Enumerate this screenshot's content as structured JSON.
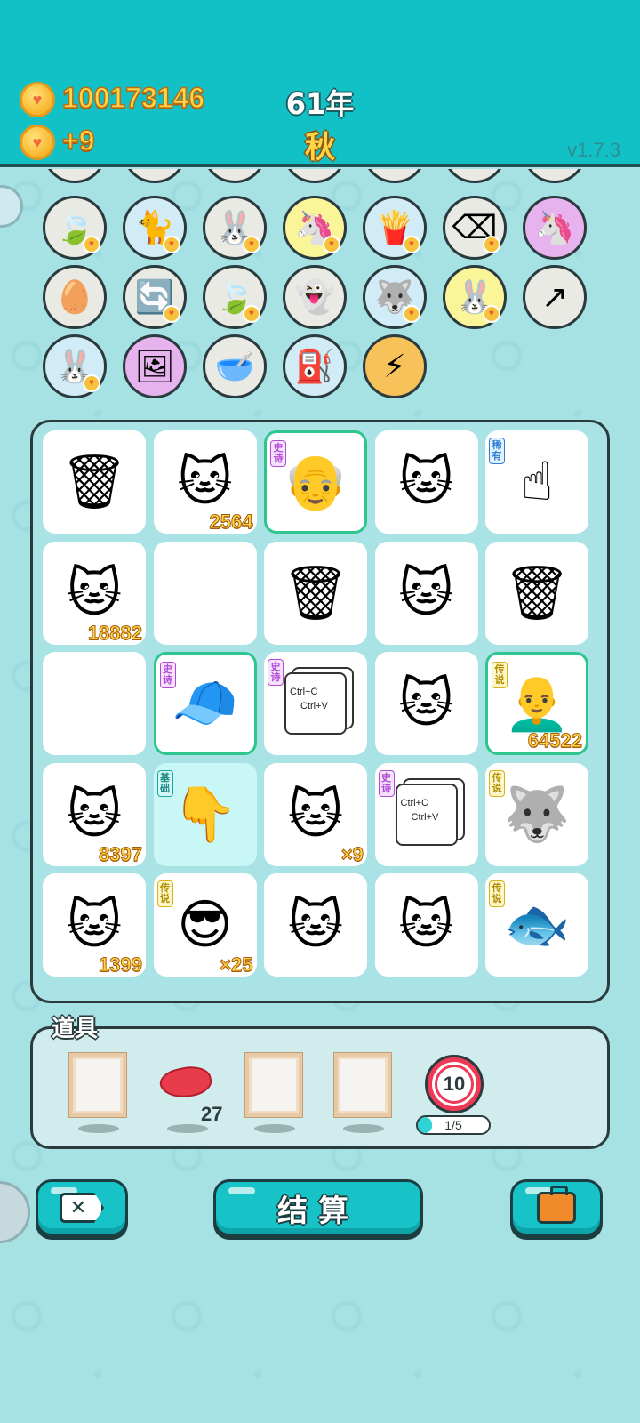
{
  "header": {
    "gold_amount": "100173146",
    "gold_income": "+9",
    "year": "61年",
    "season": "秋",
    "version": "v1.7.3"
  },
  "items_rows": [
    [
      {
        "name": "leaf-icon",
        "glyph": "🍃",
        "bg": "#e8eae3",
        "heart": true
      },
      {
        "name": "cat-back-icon",
        "glyph": "🐈",
        "bg": "#d2ecf7",
        "heart": true
      },
      {
        "name": "rabbit-icon",
        "glyph": "🐰",
        "bg": "#e8eae3",
        "heart": true
      },
      {
        "name": "unicorn-icon",
        "glyph": "🦄",
        "bg": "#fbf59a",
        "heart": true
      },
      {
        "name": "fries-icon",
        "glyph": "🍟",
        "bg": "#d2ecf7",
        "heart": true
      },
      {
        "name": "delete-tag-icon",
        "glyph": "⌫",
        "bg": "#e8eae3",
        "heart": true
      },
      {
        "name": "unicorn-pair-icon",
        "glyph": "🦄",
        "bg": "#e7b3ef",
        "heart": false
      }
    ],
    [
      {
        "name": "egg-tray-icon",
        "glyph": "🥚",
        "bg": "#e8eae3",
        "heart": false
      },
      {
        "name": "refresh-icon",
        "glyph": "🔄",
        "bg": "#e8eae3",
        "heart": true
      },
      {
        "name": "leaf-icon",
        "glyph": "🍃",
        "bg": "#e8eae3",
        "heart": true
      },
      {
        "name": "ghost-icon",
        "glyph": "👻",
        "bg": "#e8eae3",
        "heart": false
      },
      {
        "name": "husky-icon",
        "glyph": "🐺",
        "bg": "#d2ecf7",
        "heart": true
      },
      {
        "name": "rabbit-icon",
        "glyph": "🐰",
        "bg": "#fbf59a",
        "heart": true
      },
      {
        "name": "arrow-card-icon",
        "glyph": "↗",
        "bg": "#e8eae3",
        "heart": false
      }
    ],
    [
      {
        "name": "rabbit-icon",
        "glyph": "🐰",
        "bg": "#d2ecf7",
        "heart": true
      },
      {
        "name": "crown-frame-icon",
        "glyph": "🖼",
        "bg": "#e7b3ef",
        "heart": false
      },
      {
        "name": "dog-bowl-icon",
        "glyph": "🥣",
        "bg": "#e8eae3",
        "heart": false
      },
      {
        "name": "pump-icon",
        "glyph": "⛽",
        "bg": "#d2ecf7",
        "heart": false
      },
      {
        "name": "lightning-icon",
        "glyph": "⚡",
        "bg": "#f7c25a",
        "heart": false
      }
    ]
  ],
  "board": [
    [
      {
        "name": "garbage-bag-icon",
        "glyph": "🗑",
        "tag": "",
        "tag_color": "",
        "count": "",
        "style": ""
      },
      {
        "name": "cat-icon",
        "glyph": "🐱",
        "tag": "",
        "tag_color": "",
        "count": "2564",
        "style": ""
      },
      {
        "name": "old-man-icon",
        "glyph": "👴",
        "tag": "史诗",
        "tag_color": "purple",
        "count": "",
        "style": "bordered"
      },
      {
        "name": "cat-icon",
        "glyph": "🐱",
        "tag": "",
        "tag_color": "",
        "count": "",
        "style": ""
      },
      {
        "name": "pointing-finger-icon",
        "glyph": "☝",
        "tag": "稀有",
        "tag_color": "blue",
        "count": "",
        "style": ""
      }
    ],
    [
      {
        "name": "cat-icon",
        "glyph": "🐱",
        "tag": "",
        "tag_color": "",
        "count": "18882",
        "style": ""
      },
      {
        "name": "empty-slot",
        "glyph": "",
        "tag": "",
        "tag_color": "",
        "count": "",
        "style": ""
      },
      {
        "name": "garbage-bag-icon",
        "glyph": "🗑",
        "tag": "",
        "tag_color": "",
        "count": "",
        "style": ""
      },
      {
        "name": "cat-icon",
        "glyph": "🐱",
        "tag": "",
        "tag_color": "",
        "count": "",
        "style": ""
      },
      {
        "name": "garbage-bag-icon",
        "glyph": "🗑",
        "tag": "",
        "tag_color": "",
        "count": "",
        "style": ""
      }
    ],
    [
      {
        "name": "empty-slot",
        "glyph": "",
        "tag": "",
        "tag_color": "",
        "count": "",
        "style": ""
      },
      {
        "name": "red-cap-boy-icon",
        "glyph": "🧢",
        "tag": "史诗",
        "tag_color": "purple",
        "count": "",
        "style": "bordered"
      },
      {
        "name": "copy-paste-icon",
        "glyph": "",
        "tag": "史诗",
        "tag_color": "purple",
        "count": "",
        "style": "",
        "ctrl": true
      },
      {
        "name": "cat-icon",
        "glyph": "🐱",
        "tag": "",
        "tag_color": "",
        "count": "",
        "style": ""
      },
      {
        "name": "bald-grandpa-icon",
        "glyph": "👨‍🦲",
        "tag": "传说",
        "tag_color": "yellow",
        "count": "64522",
        "style": "bordered"
      }
    ],
    [
      {
        "name": "cat-icon",
        "glyph": "🐱",
        "tag": "",
        "tag_color": "",
        "count": "8397",
        "style": ""
      },
      {
        "name": "pointing-down-icon",
        "glyph": "👇",
        "tag": "基础",
        "tag_color": "teal",
        "count": "",
        "style": "highlight"
      },
      {
        "name": "cat-icon",
        "glyph": "🐱",
        "tag": "",
        "tag_color": "",
        "count": "×9",
        "style": ""
      },
      {
        "name": "copy-paste-icon",
        "glyph": "",
        "tag": "史诗",
        "tag_color": "purple",
        "count": "",
        "style": "",
        "ctrl": true
      },
      {
        "name": "crowned-husky-icon",
        "glyph": "🐺",
        "tag": "传说",
        "tag_color": "yellow",
        "count": "",
        "style": ""
      }
    ],
    [
      {
        "name": "cat-icon",
        "glyph": "🐱",
        "tag": "",
        "tag_color": "",
        "count": "1399",
        "style": ""
      },
      {
        "name": "sunglasses-man-icon",
        "glyph": "😎",
        "tag": "传说",
        "tag_color": "yellow",
        "count": "×25",
        "style": ""
      },
      {
        "name": "cat-icon",
        "glyph": "🐱",
        "tag": "",
        "tag_color": "",
        "count": "",
        "style": ""
      },
      {
        "name": "cat-icon",
        "glyph": "🐱",
        "tag": "",
        "tag_color": "",
        "count": "",
        "style": ""
      },
      {
        "name": "koi-fish-icon",
        "glyph": "🐟",
        "tag": "传说",
        "tag_color": "yellow",
        "count": "",
        "style": ""
      }
    ]
  ],
  "ctrl_text": {
    "line1": "Ctrl+C",
    "line2": "Ctrl+V"
  },
  "tools": {
    "title": "道具",
    "liver_count": "27",
    "target_value": "10",
    "progress_text": "1/5",
    "progress_fraction": 0.2
  },
  "buttons": {
    "settle_label": "结算"
  }
}
